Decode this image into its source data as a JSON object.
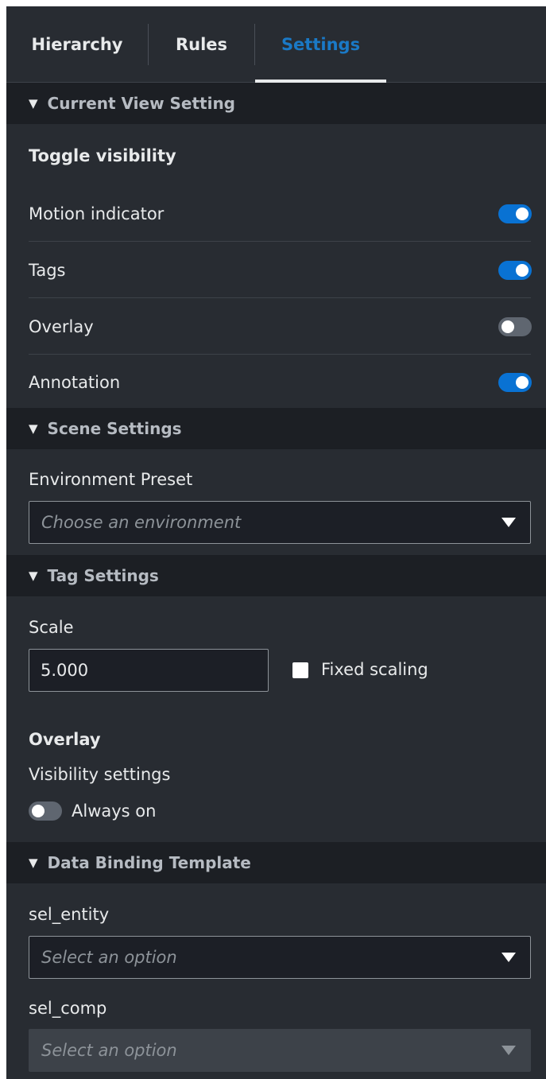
{
  "tabs": [
    {
      "label": "Hierarchy"
    },
    {
      "label": "Rules"
    },
    {
      "label": "Settings"
    }
  ],
  "current_view": {
    "header": "Current View Setting",
    "toggle_title": "Toggle visibility",
    "toggles": [
      {
        "label": "Motion indicator",
        "on": true
      },
      {
        "label": "Tags",
        "on": true
      },
      {
        "label": "Overlay",
        "on": false
      },
      {
        "label": "Annotation",
        "on": true
      }
    ]
  },
  "scene": {
    "header": "Scene Settings",
    "env_label": "Environment Preset",
    "env_placeholder": "Choose an environment"
  },
  "tag": {
    "header": "Tag Settings",
    "scale_label": "Scale",
    "scale_value": "5.000",
    "fixed_scaling_label": "Fixed scaling",
    "fixed_scaling_checked": false,
    "overlay_title": "Overlay",
    "visibility_label": "Visibility settings",
    "always_on_label": "Always on",
    "always_on": false
  },
  "binding": {
    "header": "Data Binding Template",
    "entity_label": "sel_entity",
    "entity_placeholder": "Select an option",
    "comp_label": "sel_comp",
    "comp_placeholder": "Select an option"
  },
  "colors": {
    "panel_bg": "#282c32",
    "header_bg": "#1c1f24",
    "accent": "#1a79c6",
    "toggle_on": "#0972d3",
    "toggle_off": "#5f6670"
  },
  "icons": {
    "section_expand": "triangle-down-icon",
    "select_caret": "caret-down-icon"
  }
}
